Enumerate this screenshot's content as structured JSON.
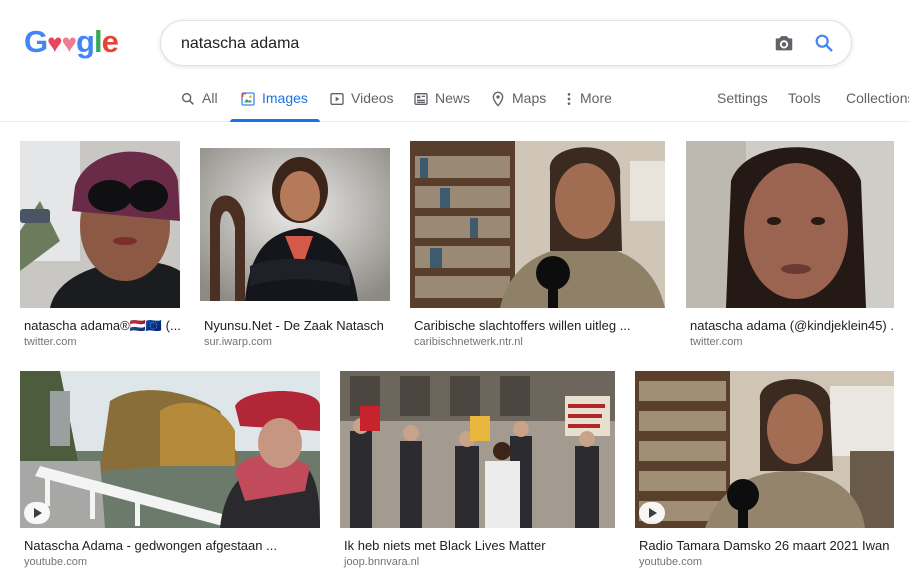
{
  "search": {
    "query": "natascha adama"
  },
  "logo": {
    "letters": [
      "G",
      "♥",
      "♥",
      "g",
      "l",
      "e"
    ]
  },
  "tabs": [
    {
      "label": "All",
      "icon": "search-icon"
    },
    {
      "label": "Images",
      "icon": "image-icon",
      "active": true
    },
    {
      "label": "Videos",
      "icon": "video-icon"
    },
    {
      "label": "News",
      "icon": "news-icon"
    },
    {
      "label": "Maps",
      "icon": "map-pin-icon"
    },
    {
      "label": "More",
      "icon": "more-vert-icon"
    }
  ],
  "tools": {
    "settings": "Settings",
    "tools": "Tools",
    "collections": "Collections"
  },
  "results": [
    {
      "caption": "natascha adama®🇳🇱🇪🇺 (...",
      "source": "twitter.com"
    },
    {
      "caption": "Nyunsu.Net - De Zaak Natasch...",
      "source": "sur.iwarp.com"
    },
    {
      "caption": "Caribische slachtoffers willen uitleg ...",
      "source": "caribischnetwerk.ntr.nl"
    },
    {
      "caption": "natascha adama (@kindjeklein45) ...",
      "source": "twitter.com"
    },
    {
      "caption": "Natascha Adama - gedwongen afgestaan ...",
      "source": "youtube.com",
      "video": true
    },
    {
      "caption": "Ik heb niets met Black Lives Matter",
      "source": "joop.bnnvara.nl"
    },
    {
      "caption": "Radio Tamara Damsko 26 maart 2021 Iwan ...",
      "source": "youtube.com",
      "video": true
    }
  ],
  "colors": {
    "accent": "#1a73e8",
    "logo_blue": "#4285f4",
    "logo_red": "#ea4335",
    "logo_heart": "#e8455f",
    "logo_green": "#34a853"
  }
}
